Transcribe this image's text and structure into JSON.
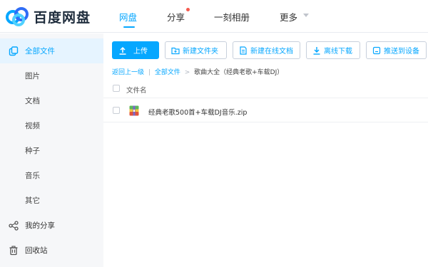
{
  "app": {
    "logo_text": "百度网盘"
  },
  "nav": {
    "items": [
      {
        "label": "网盘",
        "active": true
      },
      {
        "label": "分享",
        "has_badge": true
      },
      {
        "label": "一刻相册"
      },
      {
        "label": "更多",
        "has_dropdown": true
      }
    ]
  },
  "sidebar": {
    "items": [
      {
        "label": "全部文件",
        "icon": "files-icon",
        "active": true
      },
      {
        "label": "图片"
      },
      {
        "label": "文档"
      },
      {
        "label": "视频"
      },
      {
        "label": "种子"
      },
      {
        "label": "音乐"
      },
      {
        "label": "其它"
      },
      {
        "label": "我的分享",
        "icon": "share-icon"
      },
      {
        "label": "回收站",
        "icon": "trash-icon"
      }
    ]
  },
  "toolbar": {
    "upload": "上传",
    "new_folder": "新建文件夹",
    "new_doc": "新建在线文档",
    "offline_download": "离线下载",
    "push_device": "推送到设备"
  },
  "breadcrumb": {
    "back": "返回上一级",
    "sep1": "|",
    "all_files": "全部文件",
    "sep2": ">",
    "current": "歌曲大全（经典老歌+车载DJ）"
  },
  "file_list": {
    "header": "文件名",
    "rows": [
      {
        "name": "经典老歌500首+车载DJ音乐.zip",
        "icon": "zip-file-icon"
      }
    ]
  },
  "colors": {
    "accent": "#06a7ff",
    "sidebar_bg": "#f6f7f9",
    "active_bg": "#e6f4ff",
    "badge": "#f55a4e"
  }
}
